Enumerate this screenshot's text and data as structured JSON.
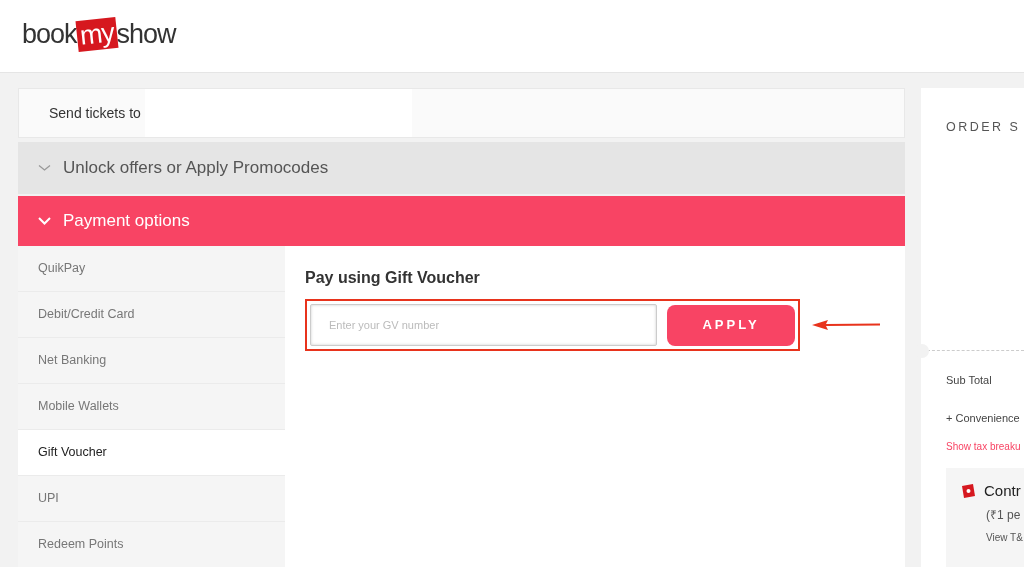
{
  "logo": {
    "before": "book",
    "highlight": "my",
    "after": "show"
  },
  "send_tickets": {
    "label": "Send tickets to"
  },
  "sections": [
    {
      "label": "Unlock offers or Apply Promocodes",
      "expanded": false
    },
    {
      "label": "Payment options",
      "expanded": true
    }
  ],
  "payment_methods": [
    {
      "label": "QuikPay",
      "selected": false
    },
    {
      "label": "Debit/Credit Card",
      "selected": false
    },
    {
      "label": "Net Banking",
      "selected": false
    },
    {
      "label": "Mobile Wallets",
      "selected": false
    },
    {
      "label": "Gift Voucher",
      "selected": true
    },
    {
      "label": "UPI",
      "selected": false
    },
    {
      "label": "Redeem Points",
      "selected": false
    }
  ],
  "gift_voucher": {
    "title": "Pay using Gift Voucher",
    "placeholder": "Enter your GV number",
    "button": "APPLY"
  },
  "order_summary": {
    "title": "ORDER S",
    "sub_total": "Sub Total",
    "convenience": "+ Convenience",
    "tax_link": "Show tax breaku",
    "contribution": {
      "title": "Contr",
      "note": "(₹1 pe",
      "link": "View T&"
    }
  }
}
